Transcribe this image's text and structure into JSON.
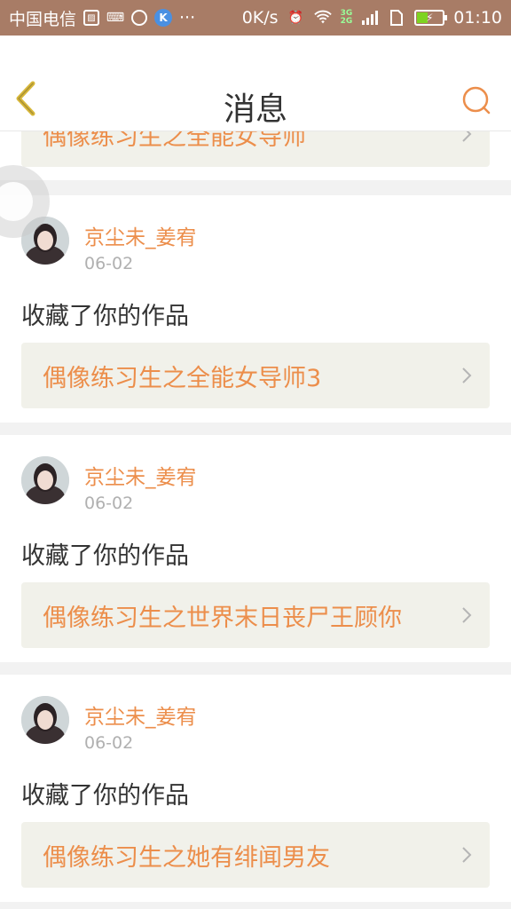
{
  "status_bar": {
    "carrier": "中国电信",
    "net_speed": "0K/s",
    "net_3g": "3G",
    "net_2g": "2G",
    "time": "01:10",
    "k_badge": "K",
    "dots": "···"
  },
  "nav": {
    "title": "消息",
    "back_icon": "chevron-left-icon",
    "search_icon": "search-icon"
  },
  "partial_item": {
    "work_title": "偶像练习生之全能女导师"
  },
  "items": [
    {
      "username": "京尘未_姜宥",
      "date": "06-02",
      "action": "收藏了你的作品",
      "work_title": "偶像练习生之全能女导师3"
    },
    {
      "username": "京尘未_姜宥",
      "date": "06-02",
      "action": "收藏了你的作品",
      "work_title": "偶像练习生之世界末日丧尸王顾你"
    },
    {
      "username": "京尘未_姜宥",
      "date": "06-02",
      "action": "收藏了你的作品",
      "work_title": "偶像练习生之她有绯闻男友"
    }
  ],
  "colors": {
    "status_bar": "#a87c66",
    "accent": "#ec8e4b",
    "link_bg": "#f1f1ea",
    "back_chevron": "#d8b83a"
  }
}
